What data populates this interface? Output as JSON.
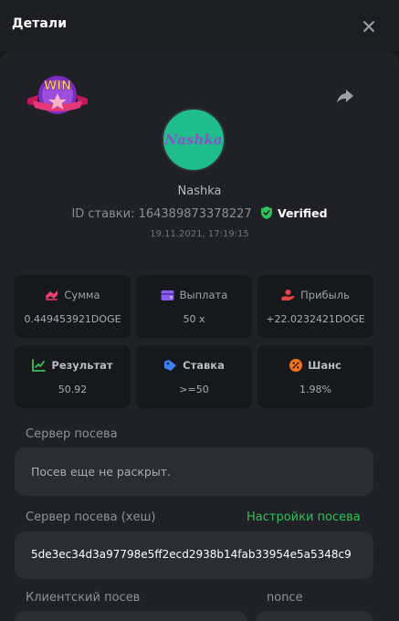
{
  "header": {
    "title": "Детали"
  },
  "bet": {
    "username": "Nashka",
    "avatar_text": "Nashka",
    "bet_id_label": "ID ставки:",
    "bet_id": "164389873378227",
    "verified_label": "Verified",
    "datetime": "19.11.2021, 17:19:15",
    "badge_text": "WIN"
  },
  "stats": [
    {
      "label": "Сумма",
      "value": "0.449453921DOGE",
      "icon": "amount-icon",
      "color": "#e8436f"
    },
    {
      "label": "Выплата",
      "value": "50 x",
      "icon": "wallet-icon",
      "color": "#8b5cf6"
    },
    {
      "label": "Прибыль",
      "value": "+22.0232421DOGE",
      "icon": "profit-icon",
      "color": "#e84545"
    },
    {
      "label": "Результат",
      "value": "50.92",
      "icon": "result-icon",
      "color": "#36c25c"
    },
    {
      "label": "Ставка",
      "value": ">=50",
      "icon": "bet-tag-icon",
      "color": "#3b82f6"
    },
    {
      "label": "Шанс",
      "value": "1.98%",
      "icon": "percent-icon",
      "color": "#f97316"
    }
  ],
  "seed": {
    "server_seed_label": "Сервер посева",
    "server_seed_value": "Посев еще не раскрыт.",
    "server_seed_hash_label": "Сервер посева (хеш)",
    "seed_settings_link": "Настройки посева",
    "server_seed_hash_value": "5de3ec34d3a97798e5ff2ecd2938b14fab33954e5a5348c9",
    "client_seed_label": "Клиентский посев",
    "nonce_label": "nonce"
  },
  "colors": {
    "accent_green": "#31c05a",
    "panel": "#1f2126",
    "card": "#16181b",
    "field": "#2a2d33"
  }
}
